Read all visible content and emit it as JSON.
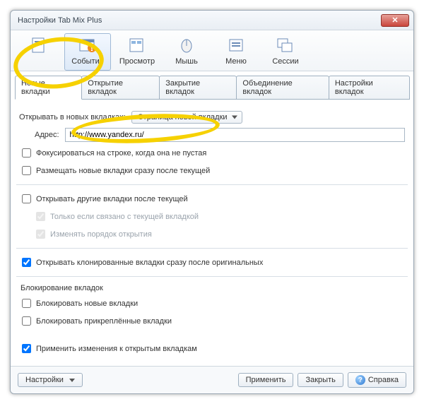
{
  "window": {
    "title": "Настройки Tab Mix Plus"
  },
  "toolbar": [
    {
      "label": ""
    },
    {
      "label": "События"
    },
    {
      "label": "Просмотр"
    },
    {
      "label": "Мышь"
    },
    {
      "label": "Меню"
    },
    {
      "label": "Сессии"
    }
  ],
  "subtabs": [
    {
      "label": "Новые вкладки"
    },
    {
      "label": "Открытие вкладок"
    },
    {
      "label": "Закрытие вкладок"
    },
    {
      "label": "Объединение вкладок"
    },
    {
      "label": "Настройки вкладок"
    }
  ],
  "open_in_new_label": "Открывать в новых вкладках:",
  "open_in_new_value": "Страница новой вкладки",
  "address_label": "Адрес:",
  "address_value": "http://www.yandex.ru/",
  "cb_focus_nonempty": "Фокусироваться на строке, когда она не пустая",
  "cb_place_after_current": "Размещать новые вкладки сразу после текущей",
  "cb_open_others_after": "Открывать другие вкладки после текущей",
  "cb_only_if_related": "Только если связано с текущей вкладкой",
  "cb_change_open_order": "Изменять порядок открытия",
  "cb_cloned_after_original": "Открывать клонированные вкладки сразу после оригинальных",
  "locking_header": "Блокирование вкладок",
  "cb_block_new": "Блокировать новые вкладки",
  "cb_block_pinned": "Блокировать прикреплённые вкладки",
  "cb_apply_to_open": "Применить изменения к открытым вкладкам",
  "buttons": {
    "settings": "Настройки",
    "apply": "Применить",
    "close": "Закрыть",
    "help": "Справка"
  }
}
